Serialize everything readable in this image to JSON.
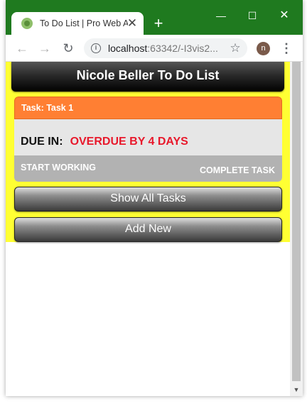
{
  "browser": {
    "tab_title": "To Do List | Pro Web A",
    "tab_close": "✕",
    "new_tab": "+",
    "window_min": "—",
    "window_max": "☐",
    "window_close": "✕",
    "url_host": "localhost",
    "url_rest": ":63342/-I3vis2...",
    "profile_initial": "n"
  },
  "page": {
    "title": "Nicole Beller To Do List",
    "task": {
      "header": "Task: Task 1",
      "due_label": "DUE IN:",
      "due_value": "OVERDUE BY 4 DAYS",
      "start_label": "START WORKING",
      "complete_label": "COMPLETE TASK"
    },
    "show_all_label": "Show All Tasks",
    "add_new_label": "Add New"
  },
  "colors": {
    "titlebar": "#1f7a1f",
    "page_background": "#ffff33",
    "task_header": "#ff7f33",
    "overdue_text": "#e8192c"
  }
}
